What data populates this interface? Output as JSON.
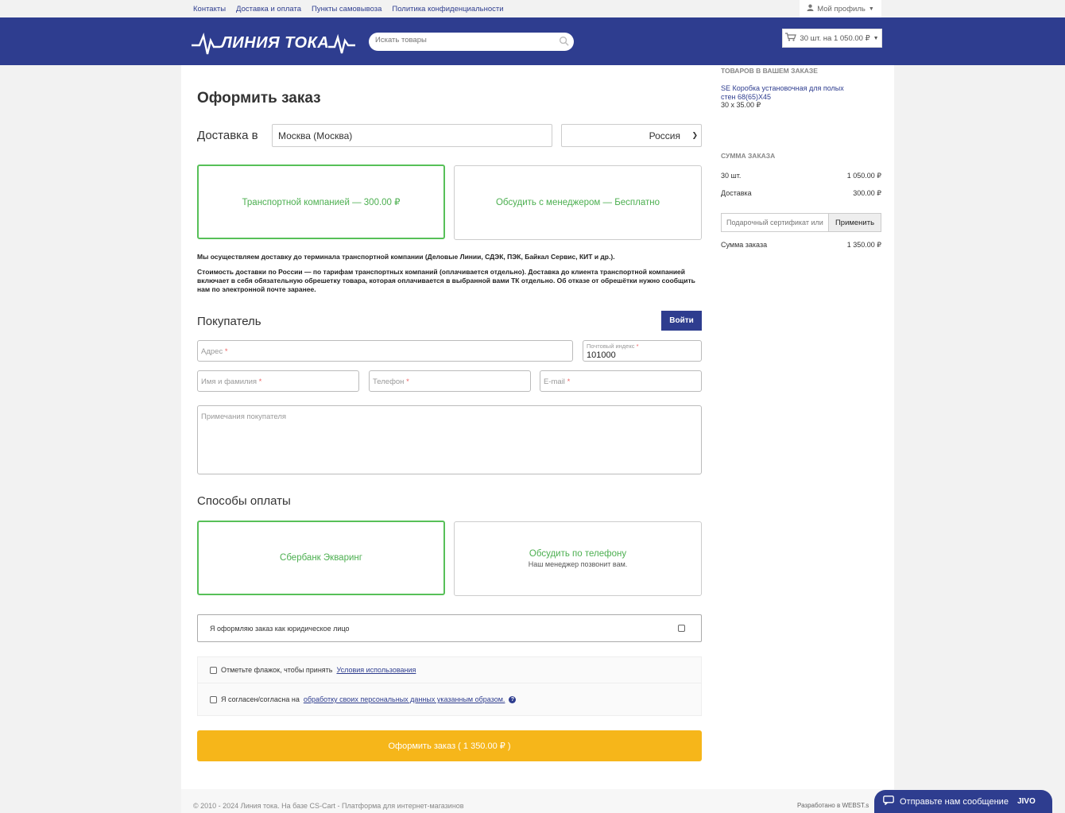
{
  "topbar": {
    "links": [
      "Контакты",
      "Доставка и оплата",
      "Пункты самовывоза",
      "Политика конфиденциальности"
    ],
    "profile_label": "Мой профиль"
  },
  "header": {
    "logo_text": "ЛИНИЯ ТОКА",
    "search_placeholder": "Искать товары",
    "cart_label": "30 шт. на 1 050.00 ₽"
  },
  "checkout": {
    "title": "Оформить заказ",
    "delivery_label": "Доставка в",
    "city_value": "Москва (Москва)",
    "country_value": "Россия",
    "shipping_options": [
      {
        "label": "Транспортной компанией — 300.00 ₽",
        "selected": true
      },
      {
        "label": "Обсудить с менеджером — Бесплатно",
        "selected": false
      }
    ],
    "note1": "Мы осуществляем доставку до терминала транспортной компании (Деловые Линии, СДЭК, ПЭК, Байкал Сервис, КИТ и др.).",
    "note2": "Стоимость доставки по России — по тарифам транспортных компаний (оплачивается отдельно). Доставка до клиента транспортной компанией включает в себя обязательную обрешетку товара, которая оплачивается в выбранной вами ТК отдельно. Об отказе от обрешётки нужно сообщить нам по электронной почте заранее.",
    "buyer_heading": "Покупатель",
    "login_label": "Войти",
    "address_placeholder": "Адрес",
    "zip_label": "Почтовый индекс",
    "zip_value": "101000",
    "name_placeholder": "Имя и фамилия",
    "phone_placeholder": "Телефон",
    "email_placeholder": "E-mail",
    "notes_placeholder": "Примечания покупателя",
    "required_mark": "*",
    "payment_heading": "Способы оплаты",
    "payment_options": [
      {
        "label": "Сбербанк Экваринг",
        "sub": "",
        "selected": true
      },
      {
        "label": "Обсудить по телефону",
        "sub": "Наш менеджер позвонит вам.",
        "selected": false
      }
    ],
    "legal_entity_label": "Я оформляю заказ как юридическое лицо",
    "terms_text": "Отметьте флажок, чтобы принять",
    "terms_link": "Условия использования",
    "consent_text": "Я согласен/согласна на",
    "consent_link": "обработку своих персональных данных указанным образом.",
    "help_glyph": "?",
    "submit_label": "Оформить заказ ( 1 350.00 ₽ )"
  },
  "sidebar": {
    "items_heading": "ТОВАРОВ В ВАШЕМ ЗАКАЗЕ",
    "product_name": "SE Коробка установочная для полых стен 68(65)Х45",
    "product_price": "30 x 35.00 ₽",
    "summary_heading": "СУММА ЗАКАЗА",
    "qty_label": "30 шт.",
    "qty_value": "1 050.00 ₽",
    "delivery_label": "Доставка",
    "delivery_value": "300.00 ₽",
    "coupon_placeholder": "Подарочный сертификат или",
    "apply_label": "Применить",
    "total_label": "Сумма заказа",
    "total_value": "1 350.00 ₽"
  },
  "footer": {
    "copyright": "© 2010 - 2024 Линия тока.  На базе CS-Cart - Платформа для интернет-магазинов",
    "developer": "Разработано в WEBST.s",
    "chat_label": "Отправьте нам сообщение",
    "chat_brand": "JIVO"
  },
  "colors": {
    "brand": "#2e3d8f",
    "accent_green": "#57c058",
    "submit": "#f6b61a"
  }
}
